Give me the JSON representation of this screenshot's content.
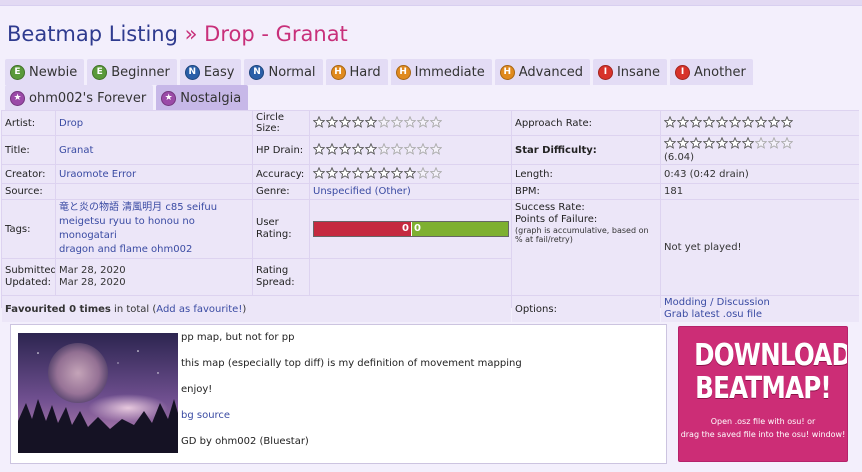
{
  "page": {
    "crumb": "Beatmap Listing",
    "separator": " » ",
    "song": "Drop - Granat"
  },
  "tabs_row1": [
    {
      "label": "Newbie",
      "icon": "E",
      "color": "#5a9a3a"
    },
    {
      "label": "Beginner",
      "icon": "E",
      "color": "#5a9a3a"
    },
    {
      "label": "Easy",
      "icon": "N",
      "color": "#2a5fa8"
    },
    {
      "label": "Normal",
      "icon": "N",
      "color": "#2a5fa8"
    },
    {
      "label": "Hard",
      "icon": "H",
      "color": "#e08a1e"
    },
    {
      "label": "Immediate",
      "icon": "H",
      "color": "#e08a1e"
    },
    {
      "label": "Advanced",
      "icon": "H",
      "color": "#e08a1e"
    },
    {
      "label": "Insane",
      "icon": "I",
      "color": "#d8322a"
    },
    {
      "label": "Another",
      "icon": "I",
      "color": "#d8322a"
    }
  ],
  "tabs_row2": [
    {
      "label": "ohm002's Forever",
      "icon": "★",
      "color": "#9b4aa8"
    },
    {
      "label": "Nostalgia",
      "icon": "★",
      "color": "#9b4aa8",
      "active": true
    }
  ],
  "info": {
    "artist_label": "Artist:",
    "artist": "Drop",
    "title_label": "Title:",
    "title": "Granat",
    "creator_label": "Creator:",
    "creator": "Uraomote Error",
    "source_label": "Source:",
    "source": "",
    "tags_label": "Tags:",
    "tags_line1": "竜と炎の物語 清風明月 c85 seifuu",
    "tags_line2": "meigetsu ryuu to honou no monogatari",
    "tags_line3": "dragon and flame ohm002",
    "submitted_label": "Submitted:",
    "submitted": "Mar 28, 2020",
    "updated_label": "Updated:",
    "updated": "Mar 28, 2020",
    "circle_size_label": "Circle Size:",
    "circle_size_filled": 5,
    "hp_drain_label": "HP Drain:",
    "hp_drain_filled": 5,
    "accuracy_label": "Accuracy:",
    "accuracy_filled": 8,
    "genre_label": "Genre:",
    "genre": "Unspecified (Other)",
    "user_rating_label1": "User",
    "user_rating_label2": "Rating:",
    "rating_negative": "0",
    "rating_positive": "0",
    "rating_spread_label1": "Rating",
    "rating_spread_label2": "Spread:",
    "approach_rate_label": "Approach Rate:",
    "approach_rate_filled": 10,
    "star_difficulty_label": "Star Difficulty:",
    "star_difficulty_filled": 7,
    "star_difficulty_value": "(6.04)",
    "length_label": "Length:",
    "length": "0:43 (0:42 drain)",
    "bpm_label": "BPM:",
    "bpm": "181",
    "success_rate_label": "Success Rate:",
    "points_of_failure_label": "Points of Failure:",
    "failure_note": "(graph is accumulative, based on % at fail/retry)",
    "not_played": "Not yet played!",
    "favourited_strong": "Favourited 0 times",
    "favourited_rest": " in total (",
    "add_favourite": "Add as favourite!",
    "favourited_close": ")",
    "options_label": "Options:",
    "modding_link": "Modding / Discussion",
    "grab_link": "Grab latest .osu file"
  },
  "description": {
    "line1": "pp map, but not for pp",
    "line2": "this map (especially top diff) is my definition of movement mapping",
    "line3": "enjoy!",
    "bg_link": "bg source",
    "line5": "GD by ohm002 (Bluestar)"
  },
  "download": {
    "line1": "DOWNLOAD",
    "line2": "BEATMAP!",
    "sub1": "Open .osz file with osu! or",
    "sub2": "drag the saved file into the osu! window!"
  },
  "colors": {
    "accent_pink": "#cc2d76",
    "title_blue": "#2f3b8f",
    "link_blue": "#3a4ba3",
    "negative_red": "#c52a3f",
    "positive_green": "#7eb030"
  }
}
